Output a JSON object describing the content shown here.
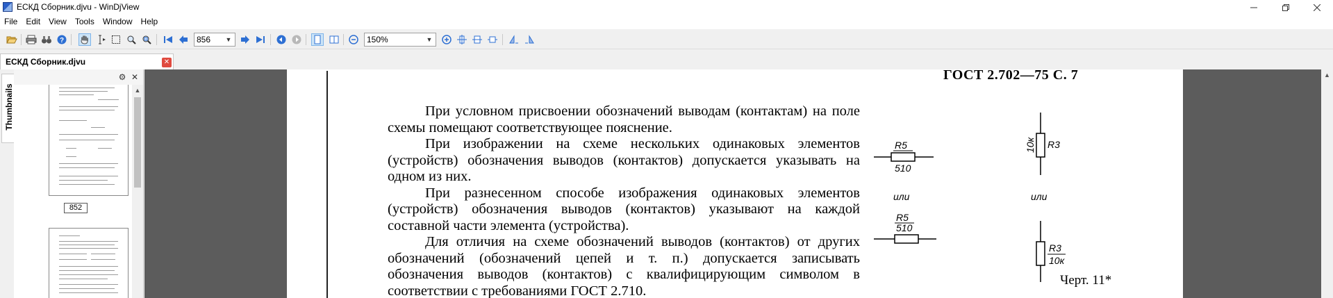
{
  "window": {
    "title": "ЕСКД Сборник.djvu - WinDjView",
    "controls": [
      "minimize",
      "restore",
      "close"
    ]
  },
  "menu": [
    "File",
    "Edit",
    "View",
    "Tools",
    "Window",
    "Help"
  ],
  "toolbar": {
    "page_number": "856",
    "zoom": "150%"
  },
  "tab": {
    "label": "ЕСКД Сборник.djvu",
    "close_color": "#e04a3f"
  },
  "sidebar": {
    "tab_label": "Thumbnails",
    "thumbnail_page_label": "852"
  },
  "document": {
    "header": "ГОСТ 2.702—75 С. 7",
    "paragraphs": [
      "При условном присвоении обозначений выводам (контактам) на поле схемы помещают соответствующее пояснение.",
      "При изображении на схеме нескольких одинаковых элементов (устройств) обозначения выводов (контактов) допускается указывать на одном из них.",
      "При разнесенном способе изображения одинаковых элементов (устройств) обозначения выводов (контактов) указывают на каждой составной части элемента (устройства).",
      "Для отличия на схеме обозначений выводов (контактов) от других обозначений (обозначений цепей и т. п.) допускается записывать обозначения выводов (контактов) с квалифицирующим символом в соответствии с требованиями ГОСТ 2.710."
    ],
    "figure": {
      "labels": {
        "r5_top": "R5",
        "r5_top_value": "510",
        "or_left": "или",
        "r5_bottom": "R5",
        "r5_bottom_value": "510",
        "r3_top": "R3",
        "r3_top_value": "10к",
        "or_right": "или",
        "r3_bottom": "R3",
        "r3_bottom_value": "10к"
      },
      "caption": "Черт. 11*"
    }
  }
}
